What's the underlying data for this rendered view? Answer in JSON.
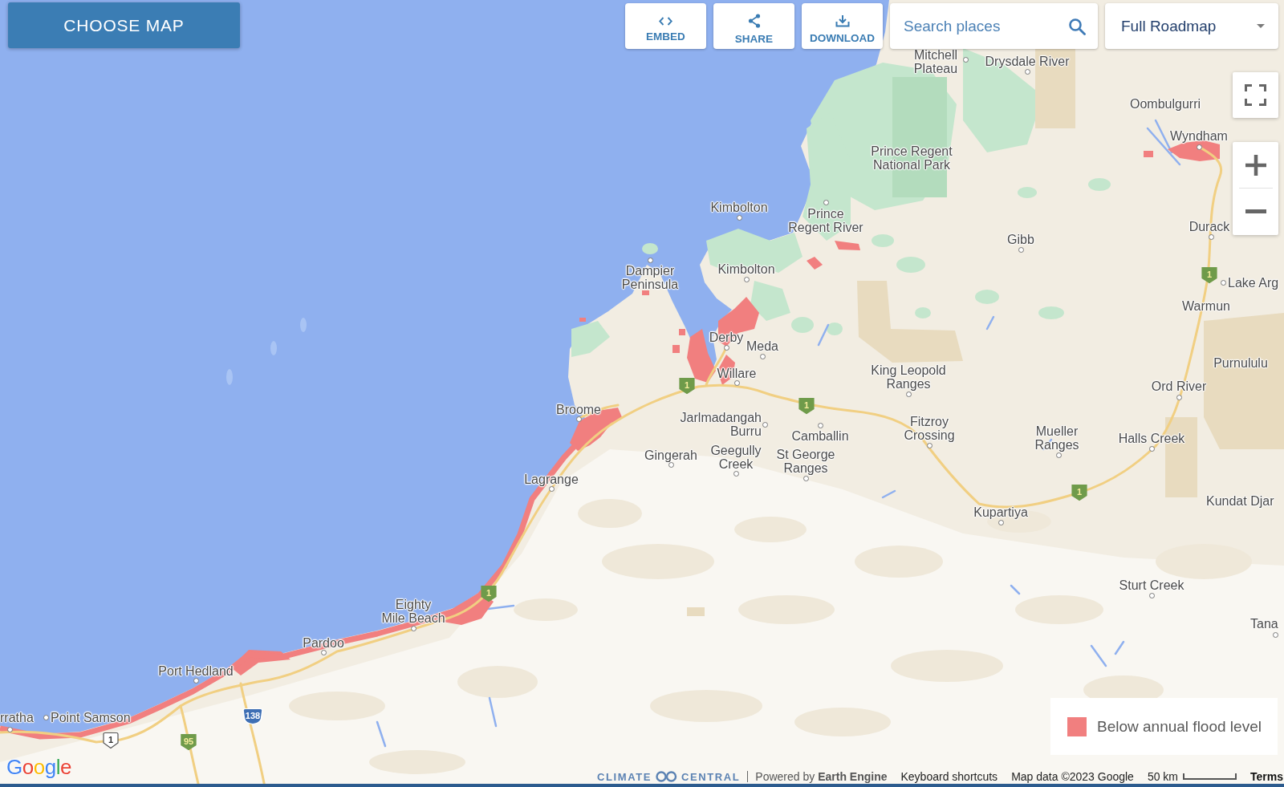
{
  "toolbar": {
    "choose_map": "CHOOSE MAP",
    "actions": [
      {
        "label": "EMBED",
        "kind": "embed"
      },
      {
        "label": "SHARE",
        "kind": "share"
      },
      {
        "label": "DOWNLOAD",
        "kind": "download"
      }
    ],
    "search": {
      "placeholder": "Search places"
    },
    "map_type": {
      "value": "Full Roadmap"
    }
  },
  "map": {
    "places": [
      {
        "lines": [
          "Mitchell",
          "Plateau"
        ]
      },
      {
        "lines": [
          "Drysdale River"
        ]
      },
      {
        "lines": [
          "Oombulgurri"
        ]
      },
      {
        "lines": [
          "Wyndham"
        ]
      },
      {
        "lines": [
          "Prince Regent",
          "National Park"
        ]
      },
      {
        "lines": [
          "Kimbolton"
        ]
      },
      {
        "lines": [
          "Prince",
          "Regent River"
        ]
      },
      {
        "lines": [
          "Durack"
        ]
      },
      {
        "lines": [
          "Gibb"
        ]
      },
      {
        "lines": [
          "Dampier",
          "Peninsula"
        ]
      },
      {
        "lines": [
          "Kimbolton"
        ]
      },
      {
        "lines": [
          "Lake Arg"
        ]
      },
      {
        "lines": [
          "Warmun"
        ]
      },
      {
        "lines": [
          "Derby"
        ]
      },
      {
        "lines": [
          "Meda"
        ]
      },
      {
        "lines": [
          "Willare"
        ]
      },
      {
        "lines": [
          "King Leopold",
          "Ranges"
        ]
      },
      {
        "lines": [
          "Purnululu"
        ]
      },
      {
        "lines": [
          "Ord River"
        ]
      },
      {
        "lines": [
          "Broome"
        ]
      },
      {
        "lines": [
          "Jarlmadangah",
          "Burru"
        ]
      },
      {
        "lines": [
          "Camballin"
        ]
      },
      {
        "lines": [
          "Fitzroy",
          "Crossing"
        ]
      },
      {
        "lines": [
          "Mueller",
          "Ranges"
        ]
      },
      {
        "lines": [
          "Halls Creek"
        ]
      },
      {
        "lines": [
          "Gingerah"
        ]
      },
      {
        "lines": [
          "Geegully",
          "Creek"
        ]
      },
      {
        "lines": [
          "St George",
          "Ranges"
        ]
      },
      {
        "lines": [
          "Lagrange"
        ]
      },
      {
        "lines": [
          "Kundat Djar"
        ]
      },
      {
        "lines": [
          "Kupartiya"
        ]
      },
      {
        "lines": [
          "Sturt Creek"
        ]
      },
      {
        "lines": [
          "Eighty",
          "Mile Beach"
        ]
      },
      {
        "lines": [
          "Tana"
        ]
      },
      {
        "lines": [
          "Pardoo"
        ]
      },
      {
        "lines": [
          "Port Hedland"
        ]
      },
      {
        "lines": [
          "rratha"
        ]
      },
      {
        "lines": [
          "Point Samson"
        ]
      }
    ],
    "route_markers": [
      {
        "label": "1",
        "kind": "national"
      },
      {
        "label": "1",
        "kind": "national"
      },
      {
        "label": "1",
        "kind": "national"
      },
      {
        "label": "1",
        "kind": "national"
      },
      {
        "label": "1",
        "kind": "national"
      },
      {
        "label": "138",
        "kind": "state"
      },
      {
        "label": "1",
        "kind": "route"
      },
      {
        "label": "95",
        "kind": "national"
      }
    ]
  },
  "legend": {
    "items": [
      {
        "label": "Below annual flood level",
        "color": "#f17f7f"
      }
    ]
  },
  "footer": {
    "brand": [
      "CLIMATE",
      "CENTRAL"
    ],
    "powered_by": "Powered by **Earth Engine**",
    "links": [
      "Keyboard shortcuts",
      "Map data ©2023 Google"
    ],
    "scale": "50 km",
    "terms": "Terms"
  },
  "logo": "Google"
}
